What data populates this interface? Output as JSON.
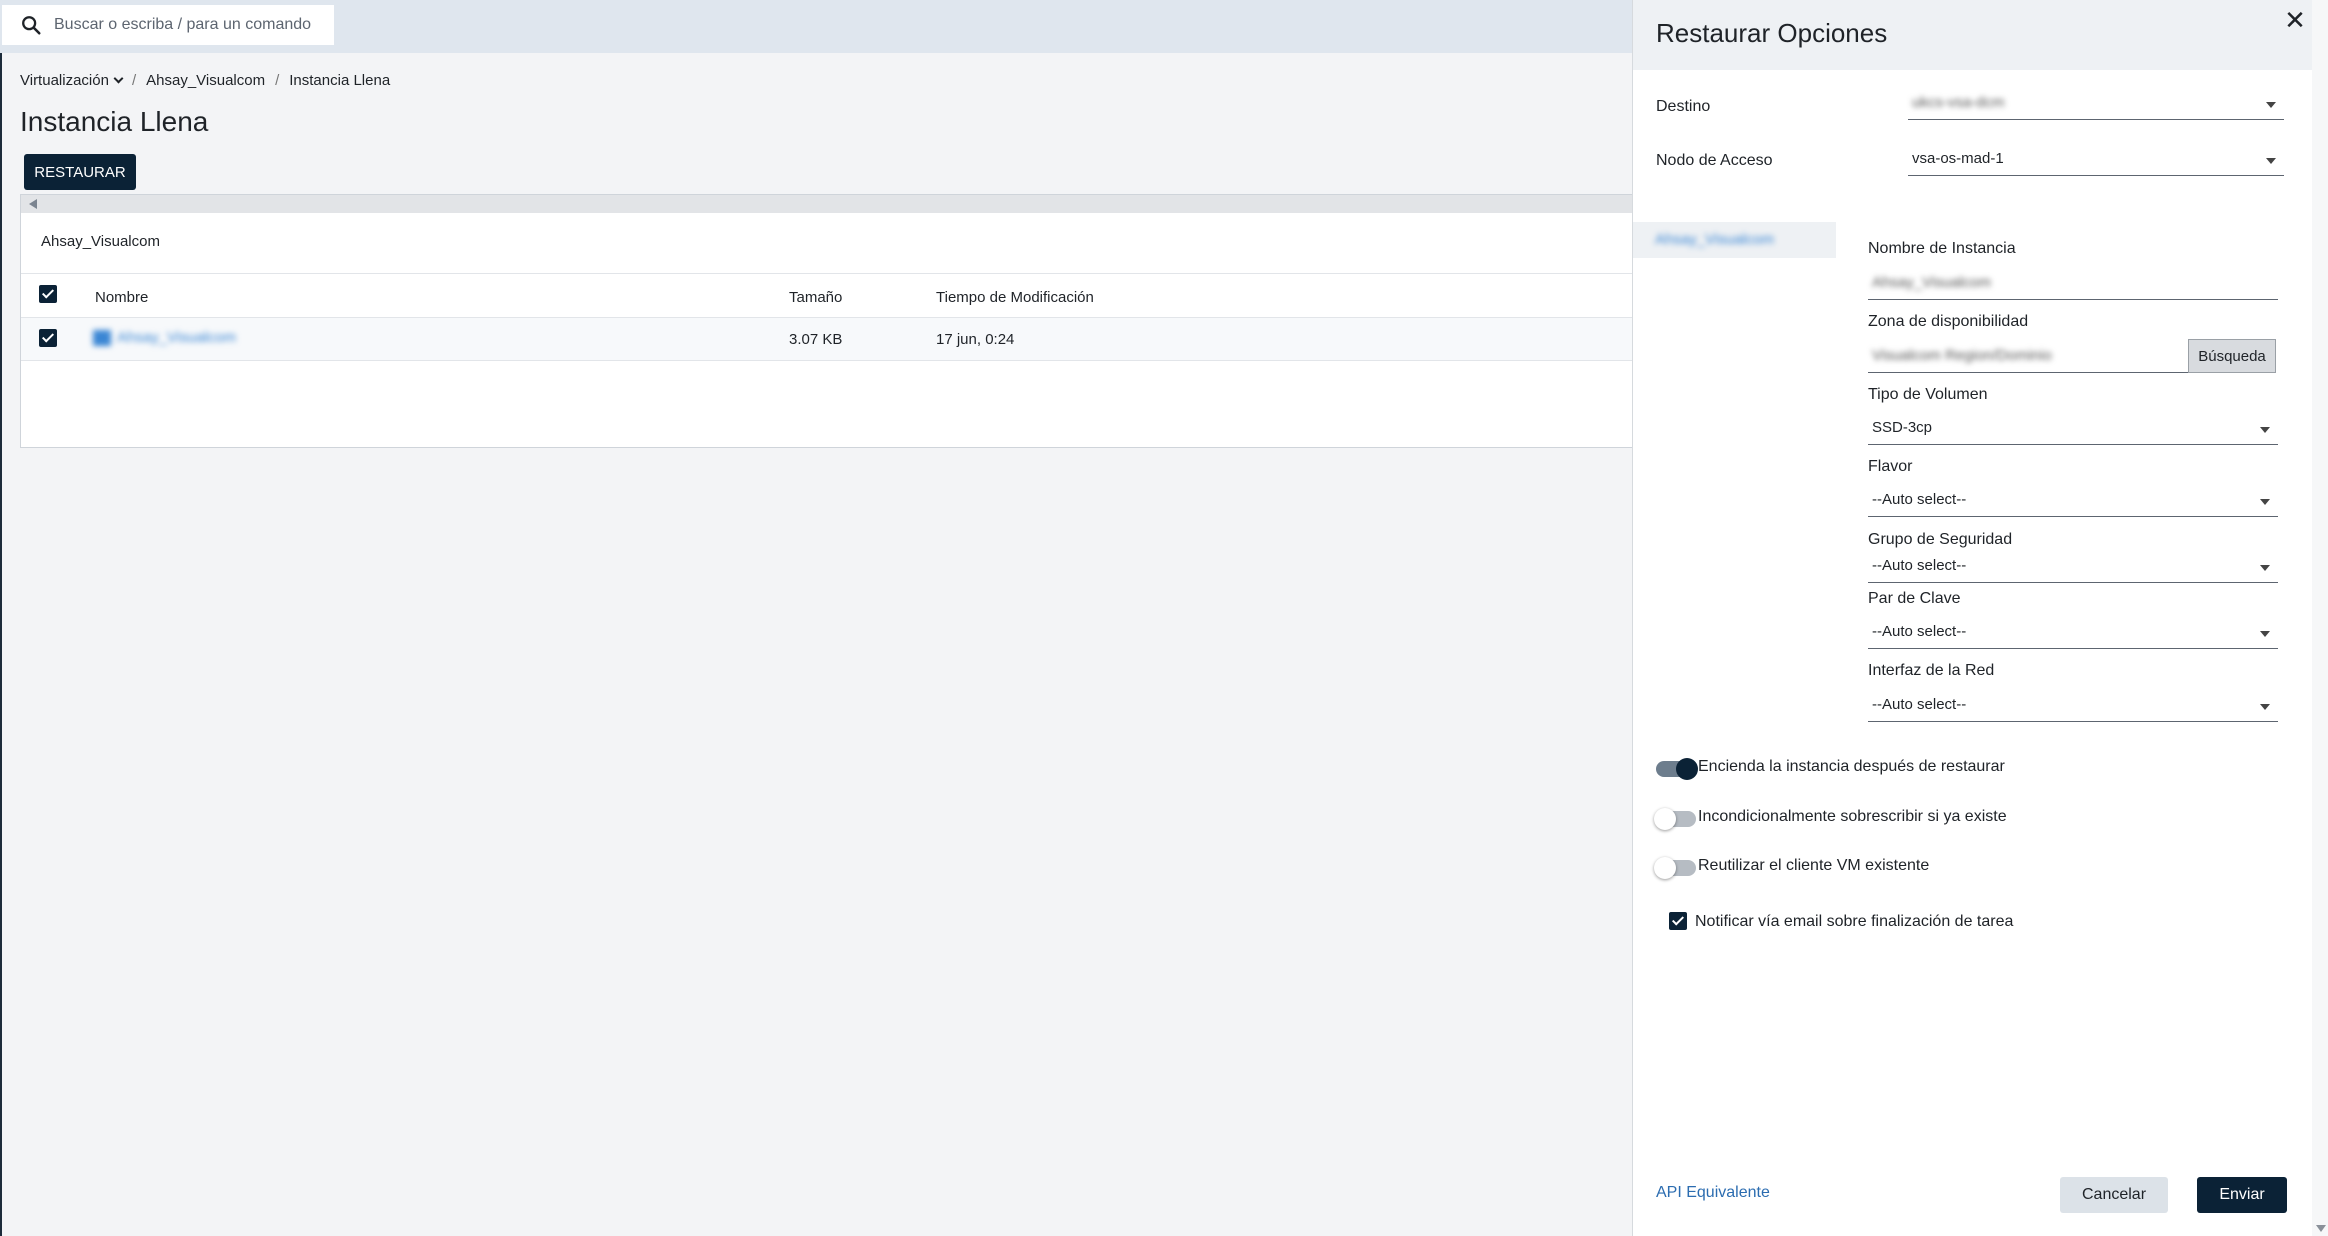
{
  "search": {
    "placeholder": "Buscar o escriba / para un comando",
    "icon": "search-icon"
  },
  "breadcrumb": {
    "items": [
      "Virtualización",
      "Ahsay_Visualcom",
      "Instancia Llena"
    ]
  },
  "page": {
    "title": "Instancia Llena",
    "restore_button": "RESTAURAR"
  },
  "panel": {
    "header": "Ahsay_Visualcom",
    "columns": [
      "Nombre",
      "Tamaño",
      "Tiempo de Modificación"
    ],
    "rows": [
      {
        "name": "Ahsay_Visualcom",
        "size": "3.07 KB",
        "modified": "17 jun, 0:24",
        "checked": true
      }
    ]
  },
  "drawer": {
    "title": "Restaurar Opciones",
    "destino_label": "Destino",
    "destino_value": "ukcs-vsa-dcm",
    "nodo_label": "Nodo de Acceso",
    "nodo_value": "vsa-os-mad-1",
    "side_item": "Ahsay_Visualcom",
    "fields": {
      "nombre_label": "Nombre de Instancia",
      "nombre_value": "Ahsay_Visualcom",
      "zona_label": "Zona de disponibilidad",
      "zona_value": "Visualcom Region/Dominio",
      "busqueda_button": "Búsqueda",
      "volumen_label": "Tipo de Volumen",
      "volumen_value": "SSD-3cp",
      "flavor_label": "Flavor",
      "flavor_value": "--Auto select--",
      "grupo_label": "Grupo de Seguridad",
      "grupo_value": "--Auto select--",
      "clave_label": "Par de Clave",
      "clave_value": "--Auto select--",
      "red_label": "Interfaz de la Red",
      "red_value": "--Auto select--"
    },
    "options": {
      "power_on": {
        "label": "Encienda la instancia después de restaurar",
        "on": true
      },
      "overwrite": {
        "label": "Incondicionalmente sobrescribir si ya existe",
        "on": false
      },
      "reuse_vm": {
        "label": "Reutilizar el cliente VM existente",
        "on": false
      },
      "notify_email": {
        "label": "Notificar vía email sobre finalización de tarea",
        "checked": true
      }
    },
    "api_link": "API Equivalente",
    "cancel_button": "Cancelar",
    "submit_button": "Enviar"
  },
  "colors": {
    "accent": "#0b2236",
    "link": "#2b6cb0"
  }
}
